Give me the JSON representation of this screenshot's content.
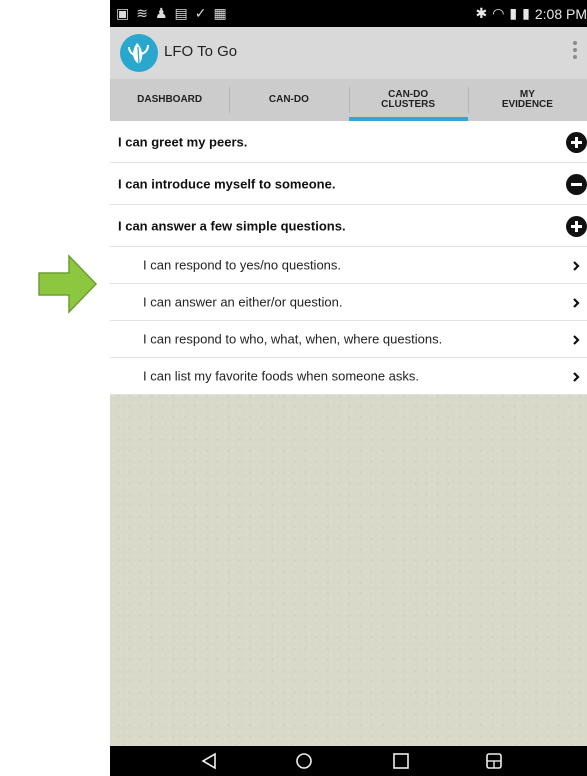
{
  "status": {
    "time": "2:08 PM"
  },
  "app": {
    "title": "LFO To Go"
  },
  "tabs": [
    {
      "label": "DASHBOARD",
      "active": false
    },
    {
      "label": "CAN-DO",
      "active": false
    },
    {
      "label": "CAN-DO\nCLUSTERS",
      "active": true
    },
    {
      "label": "MY\nEVIDENCE",
      "active": false
    }
  ],
  "list": [
    {
      "text": "I can greet my peers.",
      "level": 1,
      "icon": "plus-circle-icon"
    },
    {
      "text": "I can introduce myself to someone.",
      "level": 1,
      "icon": "minus-circle-icon"
    },
    {
      "text": "I can answer a few simple questions.",
      "level": 1,
      "icon": "plus-circle-icon"
    },
    {
      "text": "I can respond to yes/no questions.",
      "level": 2,
      "icon": "chevron-right-icon"
    },
    {
      "text": "I can answer an either/or question.",
      "level": 2,
      "icon": "chevron-right-icon"
    },
    {
      "text": "I can respond to who, what, when, where questions.",
      "level": 2,
      "icon": "chevron-right-icon"
    },
    {
      "text": "I can list my favorite foods when someone asks.",
      "level": 2,
      "icon": "chevron-right-icon"
    }
  ],
  "colors": {
    "arrow": "#8dc63f",
    "accent": "#33a7d6",
    "logo": "#29a7cf"
  }
}
